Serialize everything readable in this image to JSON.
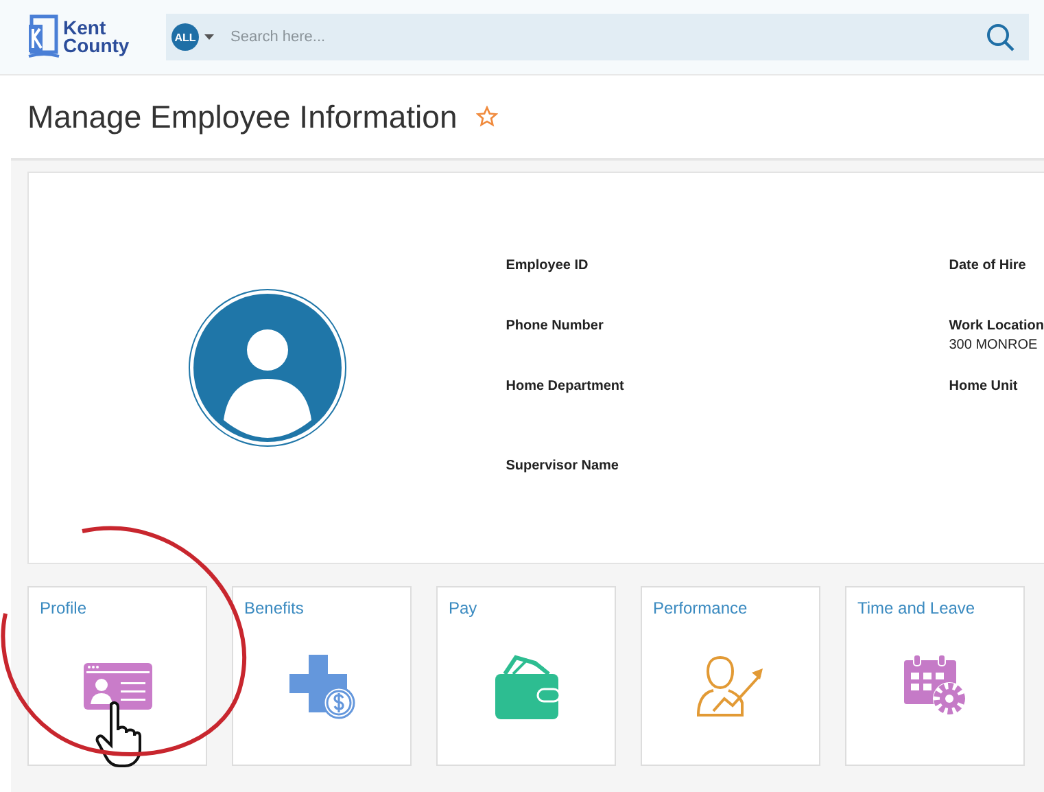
{
  "header": {
    "logo_line1": "Kent",
    "logo_line2": "County",
    "scope_badge": "ALL",
    "search": {
      "placeholder": "Search here..."
    }
  },
  "page_title": "Manage Employee Information",
  "favorite": false,
  "employee_fields": [
    {
      "label": "Employee ID"
    },
    {
      "label": "Date of Hire"
    },
    {
      "label": "Phone Number"
    },
    {
      "label": "Work Location",
      "value": "300 MONROE"
    },
    {
      "label": "Home Department"
    },
    {
      "label": "Home Unit"
    },
    {
      "label": "Supervisor Name"
    }
  ],
  "tiles": [
    {
      "label": "Profile",
      "kind": "profile",
      "highlighted": true
    },
    {
      "label": "Benefits",
      "kind": "benefits",
      "highlighted": false
    },
    {
      "label": "Pay",
      "kind": "pay",
      "highlighted": false
    },
    {
      "label": "Performance",
      "kind": "performance",
      "highlighted": false
    },
    {
      "label": "Time and Leave",
      "kind": "time",
      "highlighted": false
    }
  ]
}
